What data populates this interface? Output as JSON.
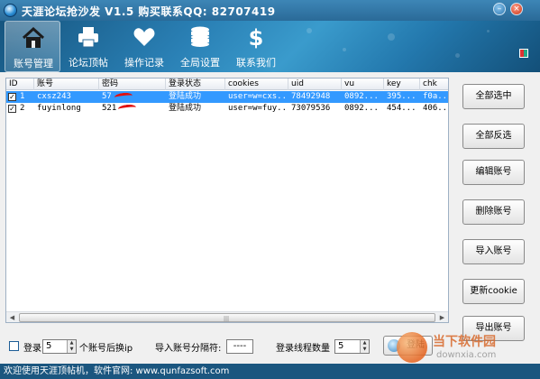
{
  "window": {
    "title": "天涯论坛抢沙发 V1.5 购买联系QQ: 82707419"
  },
  "toolbar": {
    "items": [
      {
        "label": "账号管理",
        "icon": "home-icon",
        "active": true
      },
      {
        "label": "论坛顶帖",
        "icon": "printer-icon",
        "active": false
      },
      {
        "label": "操作记录",
        "icon": "heart-icon",
        "active": false
      },
      {
        "label": "全局设置",
        "icon": "database-icon",
        "active": false
      },
      {
        "label": "联系我们",
        "icon": "dollar-icon",
        "active": false
      }
    ]
  },
  "table": {
    "columns": [
      "ID",
      "账号",
      "密码",
      "登录状态",
      "cookies",
      "uid",
      "vu",
      "key",
      "chk"
    ],
    "rows": [
      {
        "checked": true,
        "id": "1",
        "account": "cxsz243",
        "password": "57",
        "status": "登陆成功",
        "cookies": "user=w=cxs...",
        "uid": "78492948",
        "vu": "0892...",
        "key": "395...",
        "chk": "f0a..."
      },
      {
        "checked": true,
        "id": "2",
        "account": "fuyinlong",
        "password": "521",
        "status": "登陆成功",
        "cookies": "user=w=fuy...",
        "uid": "73079536",
        "vu": "0892...",
        "key": "454...",
        "chk": "406..."
      }
    ]
  },
  "actions": {
    "select_all": "全部选中",
    "invert_select": "全部反选",
    "edit_account": "编辑账号",
    "delete_account": "删除账号",
    "import_account": "导入账号",
    "update_cookie": "更新cookie",
    "export_account": "导出账号"
  },
  "bottom": {
    "login_label": "登录",
    "switch_count": "5",
    "switch_label": "个账号后换ip",
    "separator_label": "导入账号分隔符:",
    "separator_value": "----",
    "threads_label": "登录线程数量",
    "threads_value": "5",
    "login_button": "登陆"
  },
  "status_bar": {
    "text": "欢迎使用天涯顶帖机，软件官网: www.qunfazsoft.com"
  },
  "watermark": {
    "text": "当下软件园",
    "sub": "downxia.com"
  },
  "colors": {
    "selection": "#3399ff",
    "redaction": "#e01010",
    "titlebar": "#2a6a98"
  }
}
